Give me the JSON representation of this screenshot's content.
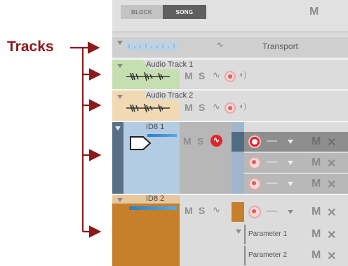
{
  "callout": {
    "label": "Tracks"
  },
  "toolbar": {
    "block_label": "BLOCK",
    "song_label": "SONG",
    "mute_label": "M"
  },
  "transport": {
    "name": "Transport"
  },
  "audio_tracks": [
    {
      "name": "Audio Track 1",
      "mute": "M",
      "solo": "S",
      "color": "#c6dfb0"
    },
    {
      "name": "Audio Track 2",
      "mute": "M",
      "solo": "S",
      "color": "#f1d9b3"
    }
  ],
  "id8_1": {
    "name": "ID8 1",
    "mute": "M",
    "solo": "S",
    "color": "#b3cbe3",
    "lanes": [
      {
        "dash": "—",
        "mute": "M",
        "close": "✕"
      },
      {
        "dash": "—",
        "mute": "M",
        "close": "✕"
      },
      {
        "dash": "—",
        "mute": "M",
        "close": "✕"
      }
    ]
  },
  "id8_2": {
    "name": "ID8 2",
    "mute": "M",
    "solo": "S",
    "color": "#c67f2b",
    "lane": {
      "dash": "—",
      "mute": "M",
      "close": "✕"
    },
    "params": [
      {
        "name": "Parameter 1",
        "mute": "M",
        "close": "✕"
      },
      {
        "name": "Parameter 2",
        "mute": "M",
        "close": "✕"
      }
    ]
  },
  "colors": {
    "arrow": "#8b1a1a",
    "record_active": "#e0262b",
    "id8_1_bg": "#b3cbe3",
    "id8_2_bg": "#c67f2b"
  },
  "icons": [
    "expand-triangle-icon",
    "waveform-icon",
    "automation-icon",
    "record-icon",
    "speaker-icon",
    "instrument-plug-icon",
    "dropdown-icon",
    "close-icon"
  ]
}
